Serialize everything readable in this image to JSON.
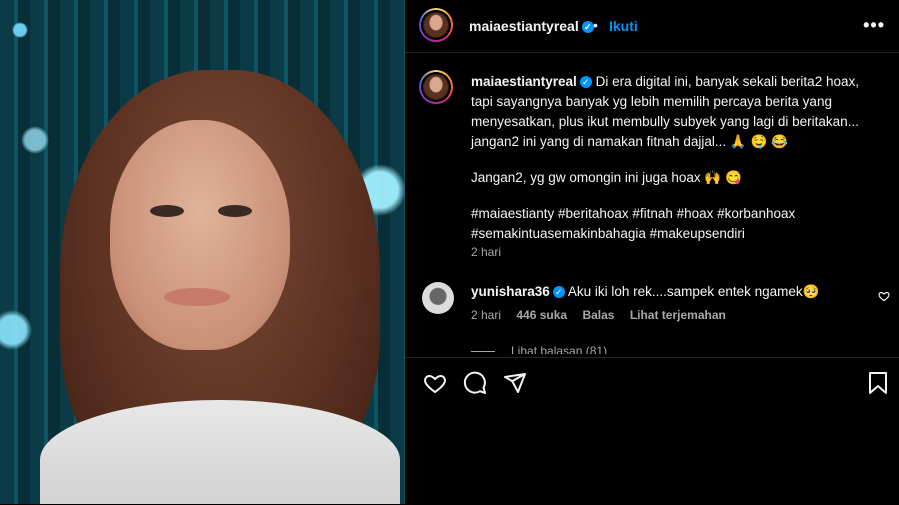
{
  "post": {
    "username": "maiaestiantyreal",
    "follow_label": "Ikuti",
    "caption_lines": [
      "Di era digital ini, banyak sekali berita2 hoax,",
      "tapi sayangnya banyak yg lebih memilih percaya berita yang",
      "menyesatkan, plus ikut membully subyek yang lagi di beritakan...",
      "jangan2 ini yang di namakan fitnah dajjal... 🙏 🤤 😂"
    ],
    "caption_line2": "Jangan2, yg gw omongin ini juga hoax 🙌 😋",
    "hashtags_1": "#maiaestianty #beritahoax #fitnah #hoax #korbanhoax",
    "hashtags_2": "#semakintuasemakinbahagia #makeupsendiri",
    "time": "2 hari"
  },
  "comment": {
    "username": "yunishara36",
    "text": "Aku iki loh rek....sampek entek ngamek🥺",
    "time": "2 hari",
    "likes": "446 suka",
    "reply": "Balas",
    "translate": "Lihat terjemahan",
    "view_replies": "Lihat balasan (81)"
  },
  "icons": {
    "like": "heart-icon",
    "comment": "comment-icon",
    "share": "send-icon",
    "save": "bookmark-icon",
    "more": "more-icon"
  },
  "colors": {
    "link": "#0095f6",
    "muted": "#a8a8a8",
    "background": "#000000"
  }
}
